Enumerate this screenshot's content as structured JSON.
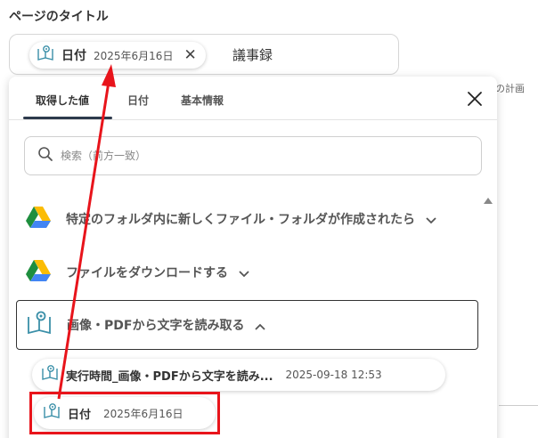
{
  "page": {
    "title_label": "ページのタイトル",
    "title_field": {
      "chip": {
        "label": "日付",
        "value": "2025年6月16日"
      },
      "suffix": "議事録"
    },
    "behind_text": "の計画"
  },
  "popup": {
    "tabs": [
      {
        "label": "取得した値",
        "active": true
      },
      {
        "label": "日付",
        "active": false
      },
      {
        "label": "基本情報",
        "active": false
      }
    ],
    "search": {
      "placeholder": "検索（前方一致）"
    },
    "sections": [
      {
        "label": "特定のフォルダ内に新しくファイル・フォルダが作成されたら",
        "icon": "google-drive-icon",
        "expanded": false
      },
      {
        "label": "ファイルをダウンロードする",
        "icon": "google-drive-icon",
        "expanded": false
      },
      {
        "label": "画像・PDFから文字を読み取る",
        "icon": "ocr-book-icon",
        "expanded": true
      }
    ],
    "outputs": [
      {
        "label": "実行時間_画像・PDFから文字を読み...",
        "value": "2025-09-18 12:53"
      },
      {
        "label": "日付",
        "value": "2025年6月16日"
      }
    ]
  },
  "colors": {
    "highlight": "#e8141b",
    "tab_underline": "#2d3a4c",
    "drive_green": "#1e8e3e",
    "drive_yellow": "#fbbc04",
    "drive_blue": "#4285f4",
    "ocr_teal": "#3a8fa8"
  }
}
